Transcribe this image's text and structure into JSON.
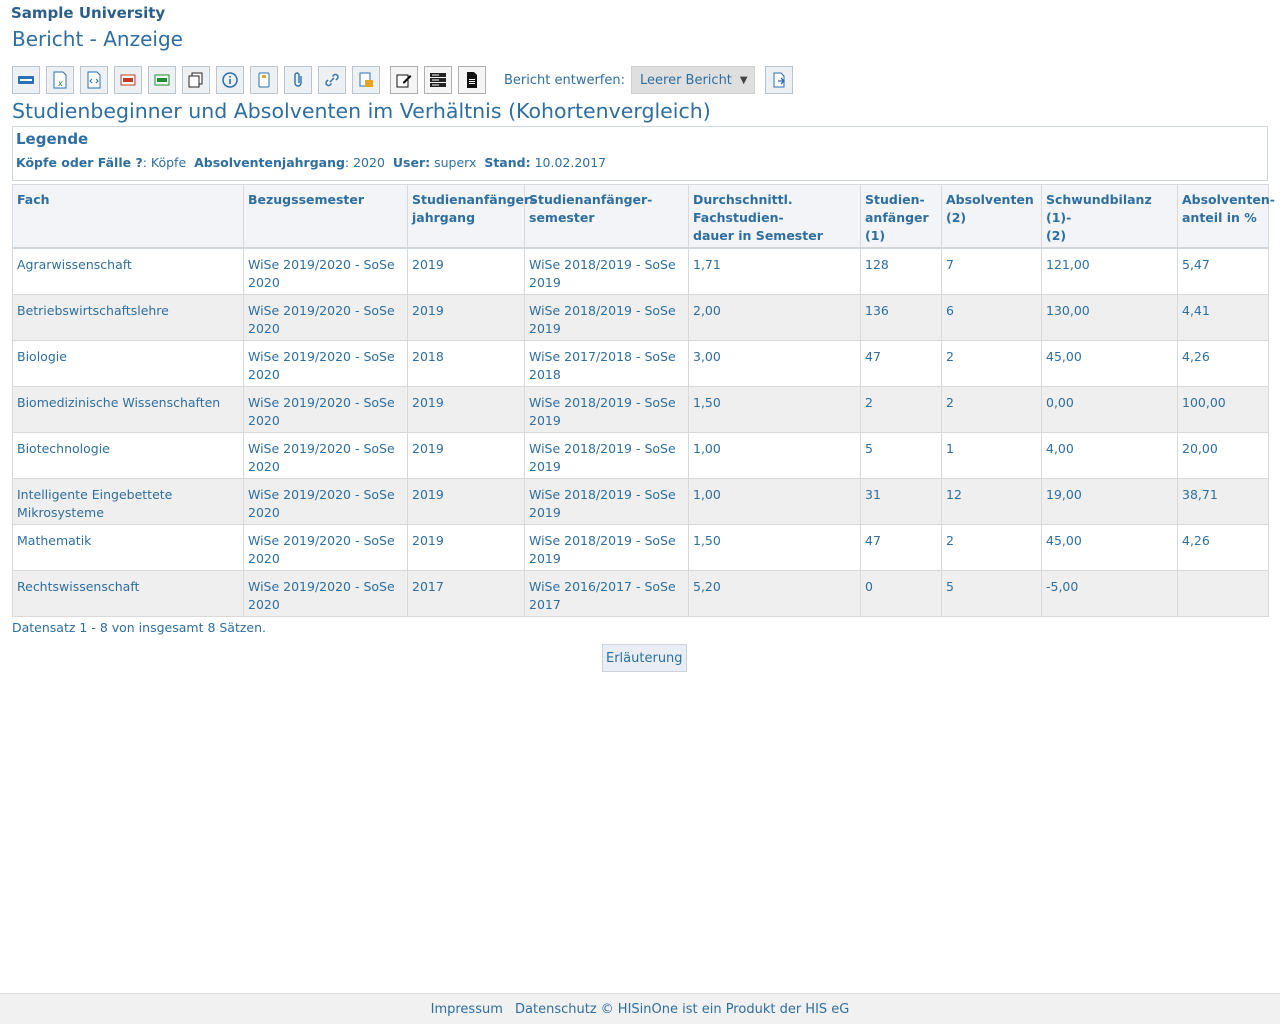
{
  "header": {
    "university": "Sample University",
    "page_title": "Bericht - Anzeige"
  },
  "toolbar": {
    "icons": [
      "html-export-icon",
      "excel-export-icon",
      "xml-export-icon",
      "pdf-export-icon",
      "csv-export-icon",
      "copy-icon",
      "info-icon",
      "notebook-icon",
      "attachment-icon",
      "link-icon",
      "report-edit-icon",
      "edit-pen-icon",
      "table-layout-icon",
      "document-icon"
    ],
    "design_label": "Bericht entwerfen:",
    "design_select_value": "Leerer Bericht"
  },
  "report": {
    "title": "Studienbeginner und Absolventen im Verhältnis (Kohortenvergleich)"
  },
  "legend": {
    "heading": "Legende",
    "k1": "Köpfe oder Fälle ?",
    "v1": "Köpfe",
    "k2": "Absolventenjahrgang",
    "v2": "2020",
    "k3": "User:",
    "v3": "superx",
    "k4": "Stand:",
    "v4": "10.02.2017"
  },
  "table": {
    "headers": [
      "Fach",
      "Bezugssemester",
      "Studienanfänger-\njahrgang",
      "Studienanfänger-\nsemester",
      "Durchschnittl.\nFachstudien-\ndauer in Semester",
      "Studien-\nanfänger\n(1)",
      "Absolventen\n(2)",
      "Schwundbilanz (1)-\n(2)",
      "Absolventen-\nanteil in %"
    ],
    "rows": [
      [
        "Agrarwissenschaft",
        "WiSe 2019/2020 - SoSe 2020",
        "2019",
        "WiSe 2018/2019 - SoSe 2019",
        "1,71",
        "128",
        "7",
        "121,00",
        "5,47"
      ],
      [
        "Betriebswirtschaftslehre",
        "WiSe 2019/2020 - SoSe 2020",
        "2019",
        "WiSe 2018/2019 - SoSe 2019",
        "2,00",
        "136",
        "6",
        "130,00",
        "4,41"
      ],
      [
        "Biologie",
        "WiSe 2019/2020 - SoSe 2020",
        "2018",
        "WiSe 2017/2018 - SoSe 2018",
        "3,00",
        "47",
        "2",
        "45,00",
        "4,26"
      ],
      [
        "Biomedizinische Wissenschaften",
        "WiSe 2019/2020 - SoSe 2020",
        "2019",
        "WiSe 2018/2019 - SoSe 2019",
        "1,50",
        "2",
        "2",
        "0,00",
        "100,00"
      ],
      [
        "Biotechnologie",
        "WiSe 2019/2020 - SoSe 2020",
        "2019",
        "WiSe 2018/2019 - SoSe 2019",
        "1,00",
        "5",
        "1",
        "4,00",
        "20,00"
      ],
      [
        "Intelligente Eingebettete Mikrosysteme",
        "WiSe 2019/2020 - SoSe 2020",
        "2019",
        "WiSe 2018/2019 - SoSe 2019",
        "1,00",
        "31",
        "12",
        "19,00",
        "38,71"
      ],
      [
        "Mathematik",
        "WiSe 2019/2020 - SoSe 2020",
        "2019",
        "WiSe 2018/2019 - SoSe 2019",
        "1,50",
        "47",
        "2",
        "45,00",
        "4,26"
      ],
      [
        "Rechtswissenschaft",
        "WiSe 2019/2020 - SoSe 2020",
        "2017",
        "WiSe 2016/2017 - SoSe 2017",
        "5,20",
        "0",
        "5",
        "-5,00",
        ""
      ]
    ]
  },
  "status": "Datensatz 1 - 8 von insgesamt 8 Sätzen.",
  "erlaeuterung_button": "Erläuterung",
  "footer": {
    "impressum": "Impressum",
    "datenschutz": "Datenschutz",
    "copyright": "© HISinOne ist ein Produkt der HIS eG"
  }
}
